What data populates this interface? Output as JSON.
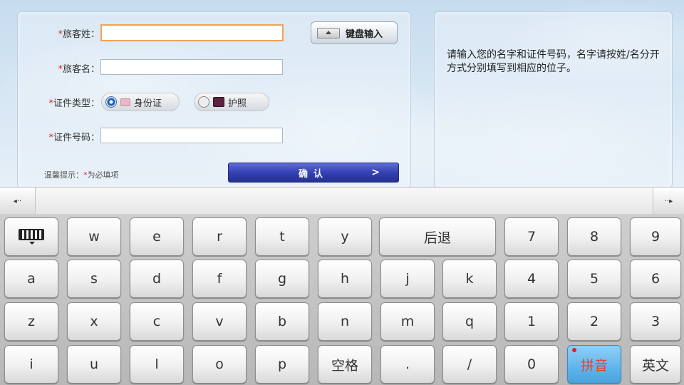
{
  "form": {
    "surname_label": "旅客姓：",
    "given_label": "旅客名：",
    "doc_type_label": "证件类型：",
    "doc_number_label": "证件号码：",
    "required_mark": "*",
    "surname_value": "",
    "given_value": "",
    "doc_number_value": "",
    "keyboard_button": "键盘输入",
    "doc_types": [
      {
        "label": "身份证",
        "selected": true
      },
      {
        "label": "护照",
        "selected": false
      }
    ],
    "hint_prefix": "温馨提示：",
    "hint_text": "为必填项",
    "confirm_label": "确认",
    "confirm_arrow": ">"
  },
  "info_text": "请输入您的名字和证件号码，名字请按姓/名分开方式分别填写到相应的位子。",
  "candidate_bar": {
    "left_arrow": "◂··",
    "right_arrow": "··▸"
  },
  "keyboard": {
    "row1": [
      "w",
      "e",
      "r",
      "t",
      "y",
      "后退",
      "7",
      "8",
      "9"
    ],
    "row2": [
      "a",
      "s",
      "d",
      "f",
      "g",
      "h",
      "j",
      "k",
      "4",
      "5",
      "6"
    ],
    "row3": [
      "z",
      "x",
      "c",
      "v",
      "b",
      "n",
      "m",
      "q",
      "1",
      "2",
      "3"
    ],
    "row4": [
      "i",
      "u",
      "l",
      "o",
      "p",
      "空格",
      ".",
      "/",
      "0",
      "拼音",
      "英文"
    ],
    "pinyin_active_color": "#5fb5ea"
  }
}
